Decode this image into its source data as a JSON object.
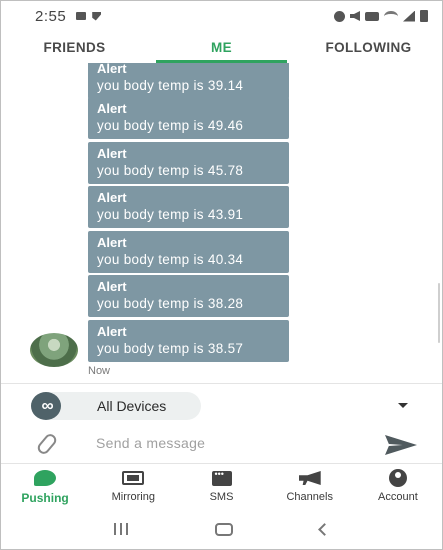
{
  "status_bar": {
    "time": "2:55",
    "icons": [
      "video-icon",
      "missed-call-icon",
      "alarm-icon",
      "mute-icon",
      "volte-icon",
      "wifi-icon",
      "signal-icon",
      "battery-icon"
    ]
  },
  "top_tabs": [
    {
      "label": "FRIENDS",
      "active": false
    },
    {
      "label": "ME",
      "active": true
    },
    {
      "label": "FOLLOWING",
      "active": false
    }
  ],
  "messages": [
    {
      "title": "Alert",
      "text": "you body temp is 39.14"
    },
    {
      "title": "Alert",
      "text": "you body temp is 49.46"
    },
    {
      "title": "Alert",
      "text": "you body temp is 45.78"
    },
    {
      "title": "Alert",
      "text": "you body temp is 43.91"
    },
    {
      "title": "Alert",
      "text": "you body temp is 40.34"
    },
    {
      "title": "Alert",
      "text": "you body temp is 38.28"
    },
    {
      "title": "Alert",
      "text": "you body temp is 38.57"
    }
  ],
  "last_message_time": "Now",
  "device_selector": {
    "icon": "infinity-icon",
    "label": "All Devices"
  },
  "compose": {
    "placeholder": "Send a message"
  },
  "bottom_nav": [
    {
      "label": "Pushing",
      "icon": "pushing-icon",
      "active": true
    },
    {
      "label": "Mirroring",
      "icon": "mirroring-icon",
      "active": false
    },
    {
      "label": "SMS",
      "icon": "sms-icon",
      "active": false
    },
    {
      "label": "Channels",
      "icon": "channels-icon",
      "active": false
    },
    {
      "label": "Account",
      "icon": "account-icon",
      "active": false
    }
  ],
  "colors": {
    "accent": "#2fa35f",
    "bubble": "#7e97a3",
    "device_icon": "#4f6269"
  }
}
